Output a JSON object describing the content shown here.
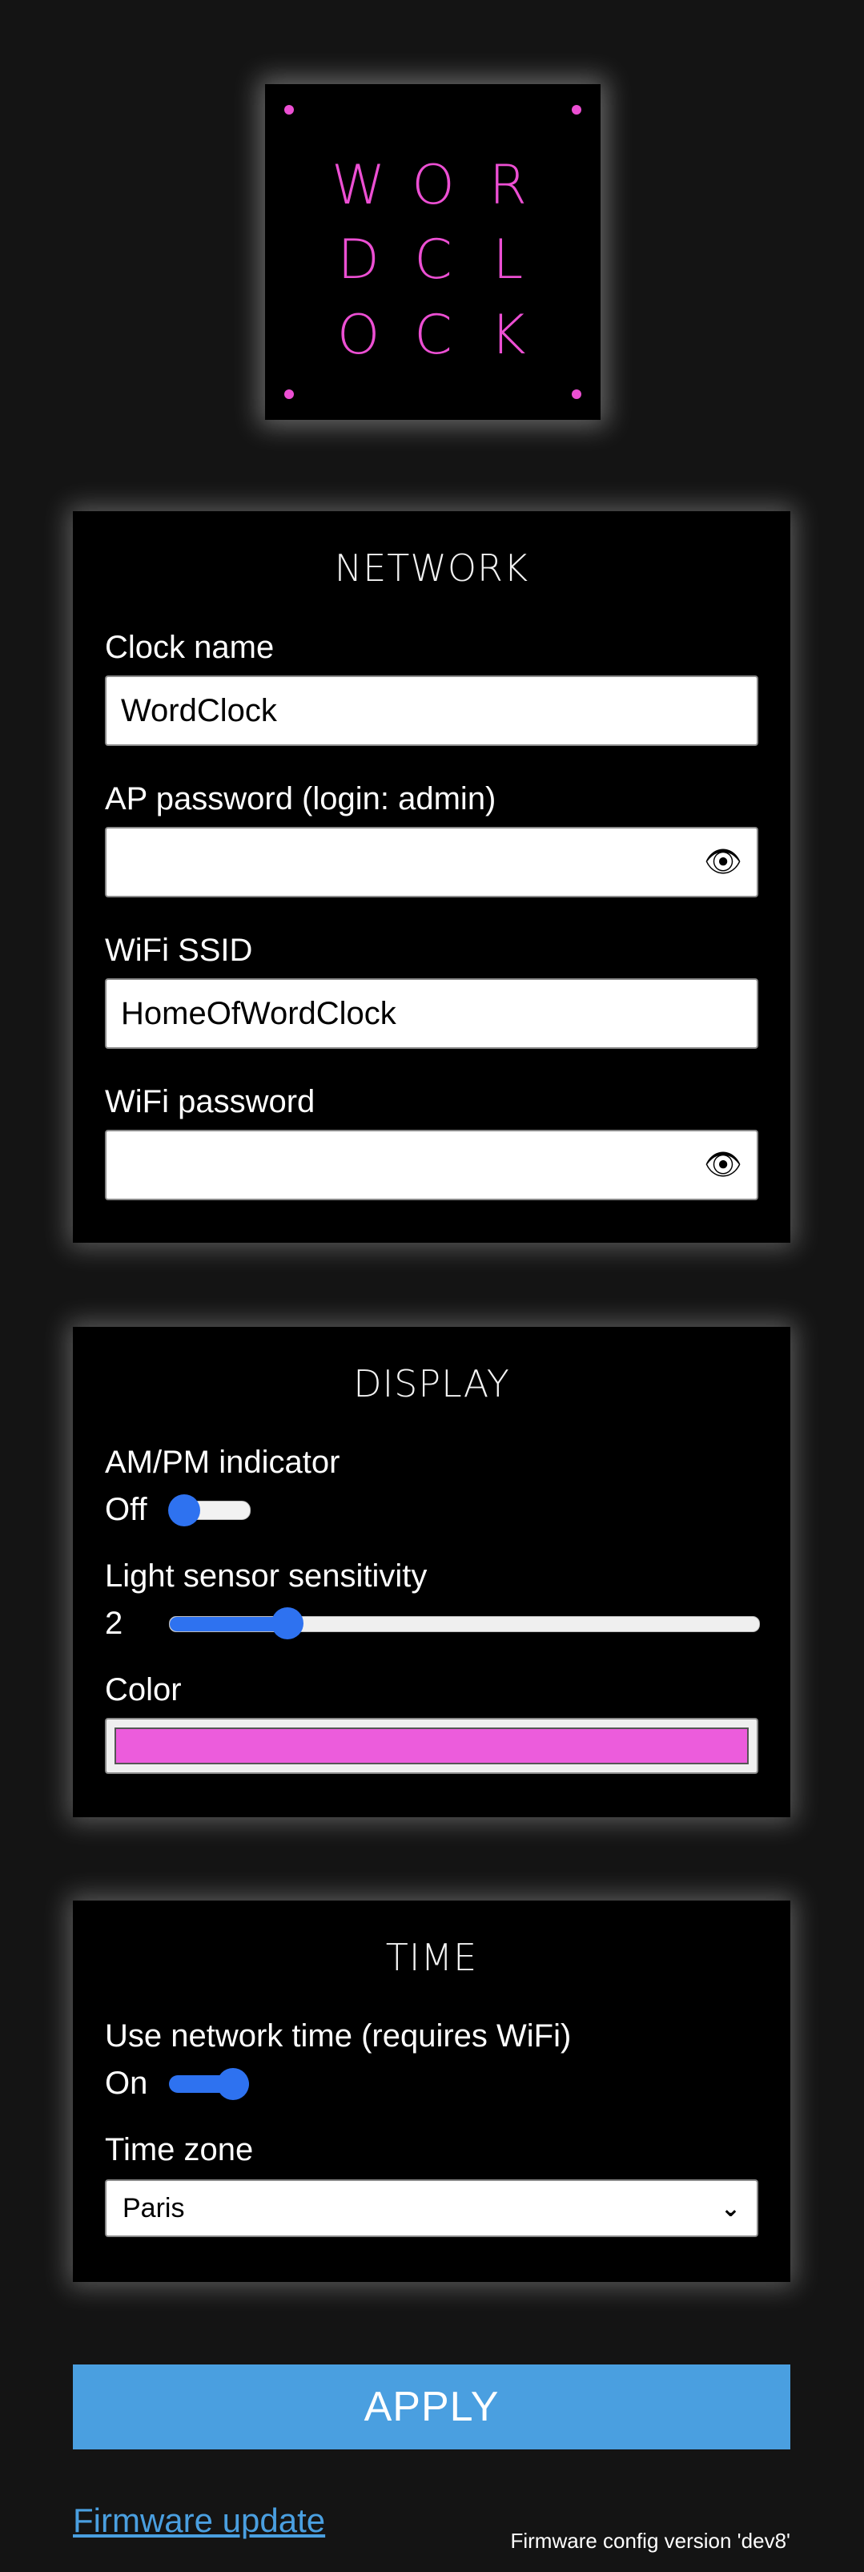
{
  "logo": {
    "letters": [
      "W",
      "O",
      "R",
      "D",
      "C",
      "L",
      "O",
      "C",
      "K"
    ],
    "accent_color": "#ec4fd3"
  },
  "network": {
    "title": "NETWORK",
    "clock_name_label": "Clock name",
    "clock_name_value": "WordClock",
    "ap_password_label": "AP password (login: admin)",
    "ap_password_value": "",
    "wifi_ssid_label": "WiFi SSID",
    "wifi_ssid_value": "HomeOfWordClock",
    "wifi_password_label": "WiFi password",
    "wifi_password_value": "",
    "reveal_icon": "eye-icon",
    "reveal_glyph": "👁"
  },
  "display": {
    "title": "DISPLAY",
    "ampm_label": "AM/PM indicator",
    "ampm_state": "Off",
    "ampm_on": false,
    "light_label": "Light sensor sensitivity",
    "light_value": "2",
    "light_fraction": 0.2,
    "color_label": "Color",
    "color_value": "#ec5cdc"
  },
  "time": {
    "title": "TIME",
    "network_time_label": "Use network time (requires WiFi)",
    "network_time_state": "On",
    "network_time_on": true,
    "timezone_label": "Time zone",
    "timezone_value": "Paris"
  },
  "footer": {
    "apply_label": "APPLY",
    "firmware_link": "Firmware update",
    "firmware_version": "Firmware config version 'dev8'"
  },
  "colors": {
    "background": "#141414",
    "toggle_blue": "#2e72f0",
    "apply_blue": "#4a9fe0"
  }
}
